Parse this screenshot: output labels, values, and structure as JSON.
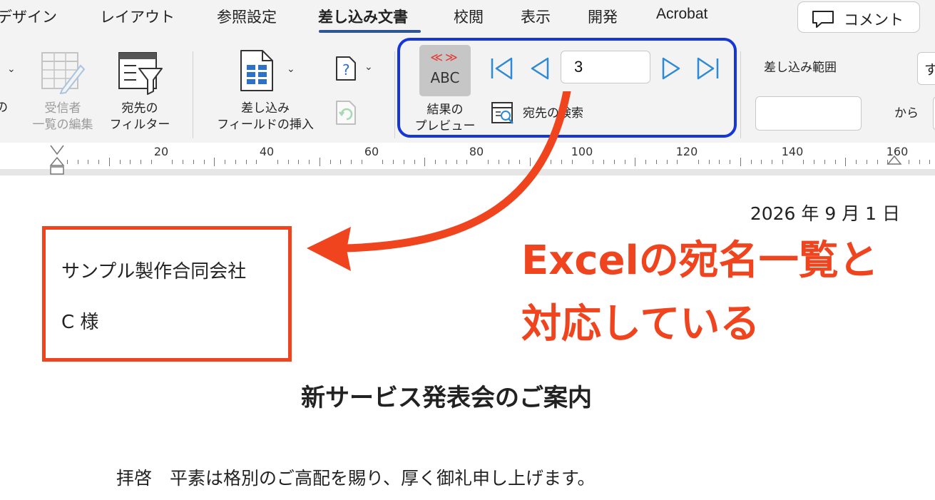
{
  "ribbon": {
    "tabs": [
      "デザイン",
      "レイアウト",
      "参照設定",
      "差し込み文書",
      "校閲",
      "表示",
      "開発",
      "Acrobat"
    ],
    "active_tab": "差し込み文書",
    "comment_label": "コメント",
    "left_cut_label": "の",
    "recipients_edit": [
      "受信者",
      "一覧の編集"
    ],
    "filter": [
      "宛先の",
      "フィルター"
    ],
    "insert_field": [
      "差し込み",
      "フィールドの挿入"
    ],
    "preview_arrows": "≪≫",
    "preview_abc": "ABC",
    "preview_label": [
      "結果の",
      "プレビュー"
    ],
    "record_number": "3",
    "find_recipient": "宛先の検索",
    "merge_range_label": "差し込み範囲",
    "range_dropdown_cut": "す",
    "from_label": "から",
    "accent_color": "#2f5597",
    "frame_color": "#1636d8"
  },
  "ruler": {
    "labels": [
      "20",
      "40",
      "60",
      "80",
      "100",
      "120",
      "140",
      "160"
    ]
  },
  "document": {
    "date": "2026 年 9 月 1 日",
    "company": "サンプル製作合同会社",
    "honorific": "C 様",
    "title": "新サービス発表会のご案内",
    "greeting": "拝啓　平素は格別のご高配を賜り、厚く御礼申し上げます。"
  },
  "annotation": {
    "line1": "Excelの宛名一覧と",
    "line2": "対応している",
    "color": "#f0441e"
  }
}
